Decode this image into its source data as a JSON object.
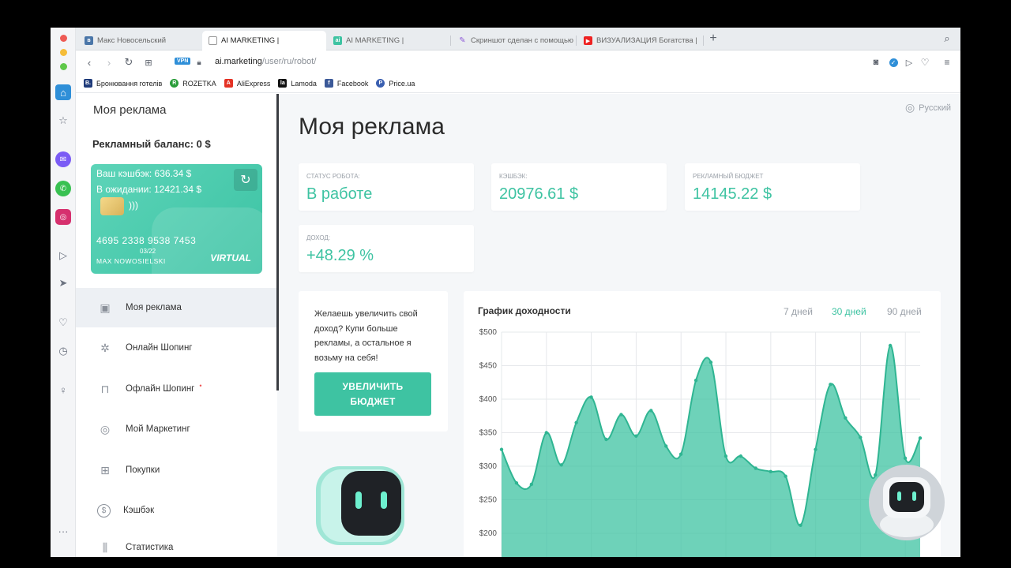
{
  "browser": {
    "tabs": [
      {
        "label": "Макс Новосельский",
        "favicon": "vk-icon",
        "color": "#4a76a8"
      },
      {
        "label": "AI MARKETING |",
        "favicon": "page-icon",
        "color": "#5b616b"
      },
      {
        "label": "AI MARKETING |",
        "favicon": "ai-icon",
        "color": "#3ec3a2"
      },
      {
        "label": "Скриншот сделан с помощью",
        "favicon": "pen-icon",
        "color": "#8f5bd8"
      },
      {
        "label": "ВИЗУАЛИЗАЦИЯ Богатства |",
        "favicon": "youtube-icon",
        "color": "#e22"
      }
    ],
    "vpn": "VPN",
    "url_host": "ai.marketing",
    "url_path": "/user/ru/robot/",
    "bookmarks": [
      {
        "label": "Бронювання готелів",
        "icon": "B.",
        "color": "#1f3b7a"
      },
      {
        "label": "ROZETKA",
        "icon": "R",
        "color": "#2a9d3a"
      },
      {
        "label": "AliExpress",
        "icon": "A",
        "color": "#e43225"
      },
      {
        "label": "Lamoda",
        "icon": "la",
        "color": "#111111"
      },
      {
        "label": "Facebook",
        "icon": "f",
        "color": "#3b5998"
      },
      {
        "label": "Price.ua",
        "icon": "P",
        "color": "#3a5fb0"
      }
    ]
  },
  "sidebar": {
    "title": "Моя реклама",
    "balance": "Рекламный баланс: 0 $",
    "card": {
      "cashback": "Ваш кэшбэк: 636.34 $",
      "pending": "В ожидании: 12421.34 $",
      "number": "4695 2338 9538 7453",
      "expiry": "03/22",
      "holder": "MAX NOWOSIELSKI",
      "type": "VIRTUAL"
    },
    "nav": [
      {
        "label": "Моя реклама",
        "icon": "ad-icon",
        "glyph": "▣"
      },
      {
        "label": "Онлайн Шопинг",
        "icon": "globe-icon",
        "glyph": "✲"
      },
      {
        "label": "Офлайн Шопинг",
        "icon": "bag-icon",
        "glyph": "⊓"
      },
      {
        "label": "Мой Маркетинг",
        "icon": "target-icon",
        "glyph": "◎"
      },
      {
        "label": "Покупки",
        "icon": "cart-icon",
        "glyph": "⊞"
      },
      {
        "label": "Кэшбэк",
        "icon": "dollar-icon",
        "glyph": "$"
      },
      {
        "label": "Статистика",
        "icon": "chart-icon",
        "glyph": "⫼"
      }
    ]
  },
  "main": {
    "language": "Русский",
    "title": "Моя реклама",
    "stats": [
      {
        "label": "СТАТУС РОБОТА:",
        "value": "В работе"
      },
      {
        "label": "КЭШБЭК:",
        "value": "20976.61 $"
      },
      {
        "label": "РЕКЛАМНЫЙ БЮДЖЕТ",
        "value": "14145.22 $"
      },
      {
        "label": "ДОХОД:",
        "value": "+48.29 %"
      }
    ],
    "promo": {
      "text": "Желаешь увеличить свой доход? Купи больше рекламы, а остальное я возьму на себя!",
      "button": "УВЕЛИЧИТЬ БЮДЖЕТ"
    },
    "chart_ranges": [
      "7 дней",
      "30 дней",
      "90 дней"
    ],
    "active_range": "30 дней"
  },
  "accent_color": "#3ec3a2",
  "chart_data": {
    "type": "area",
    "title": "График доходности",
    "xlabel": "",
    "ylabel": "",
    "y_ticks": [
      "$500",
      "$450",
      "$400",
      "$350",
      "$300",
      "$250",
      "$200"
    ],
    "ylim": [
      200,
      500
    ],
    "grid": true,
    "series": [
      {
        "values": [
          325,
          275,
          273,
          350,
          302,
          365,
          403,
          340,
          377,
          345,
          383,
          330,
          318,
          428,
          455,
          315,
          315,
          297,
          292,
          285,
          212,
          325,
          422,
          372,
          343,
          287,
          480,
          312,
          342
        ]
      }
    ]
  }
}
